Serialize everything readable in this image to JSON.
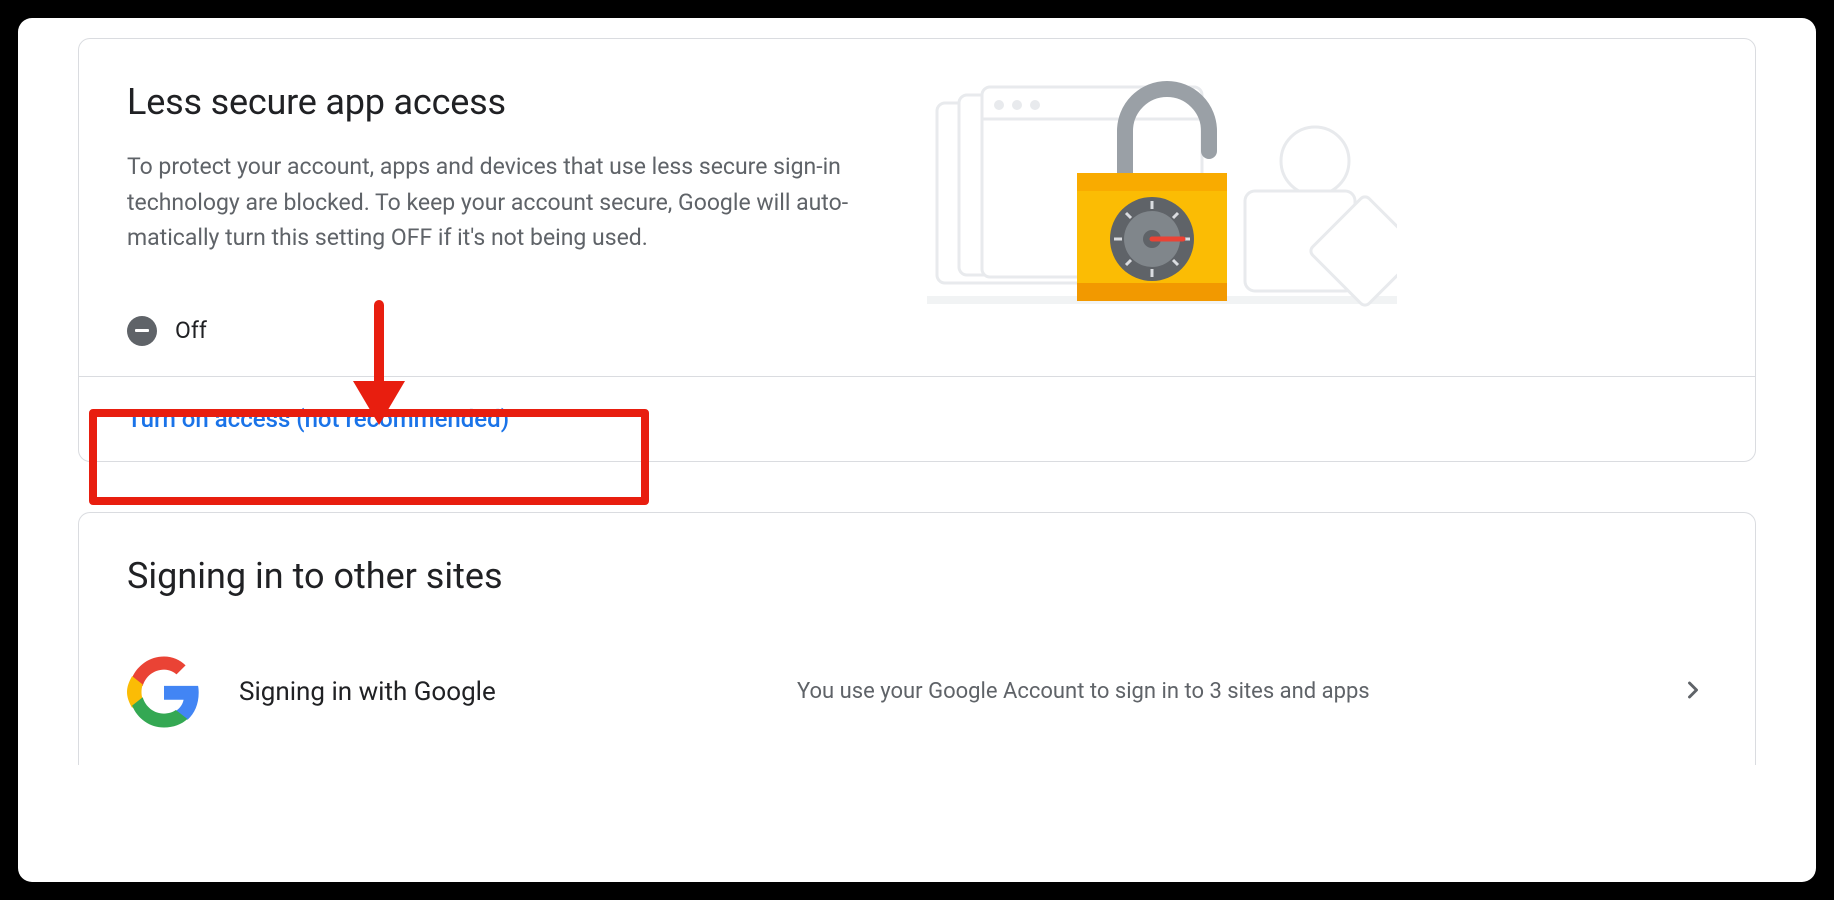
{
  "lessSecure": {
    "title": "Less secure app access",
    "description": "To protect your account, apps and devices that use less secure sign-in technology are blocked. To keep your account secure, Google will auto­matically turn this setting OFF if it's not being used.",
    "statusLabel": "Off",
    "actionLabel": "Turn on access (not recommended)"
  },
  "signingIn": {
    "title": "Signing in to other sites",
    "rowLabel": "Signing in with Google",
    "rowDesc": "You use your Google Account to sign in to 3 sites and apps"
  }
}
